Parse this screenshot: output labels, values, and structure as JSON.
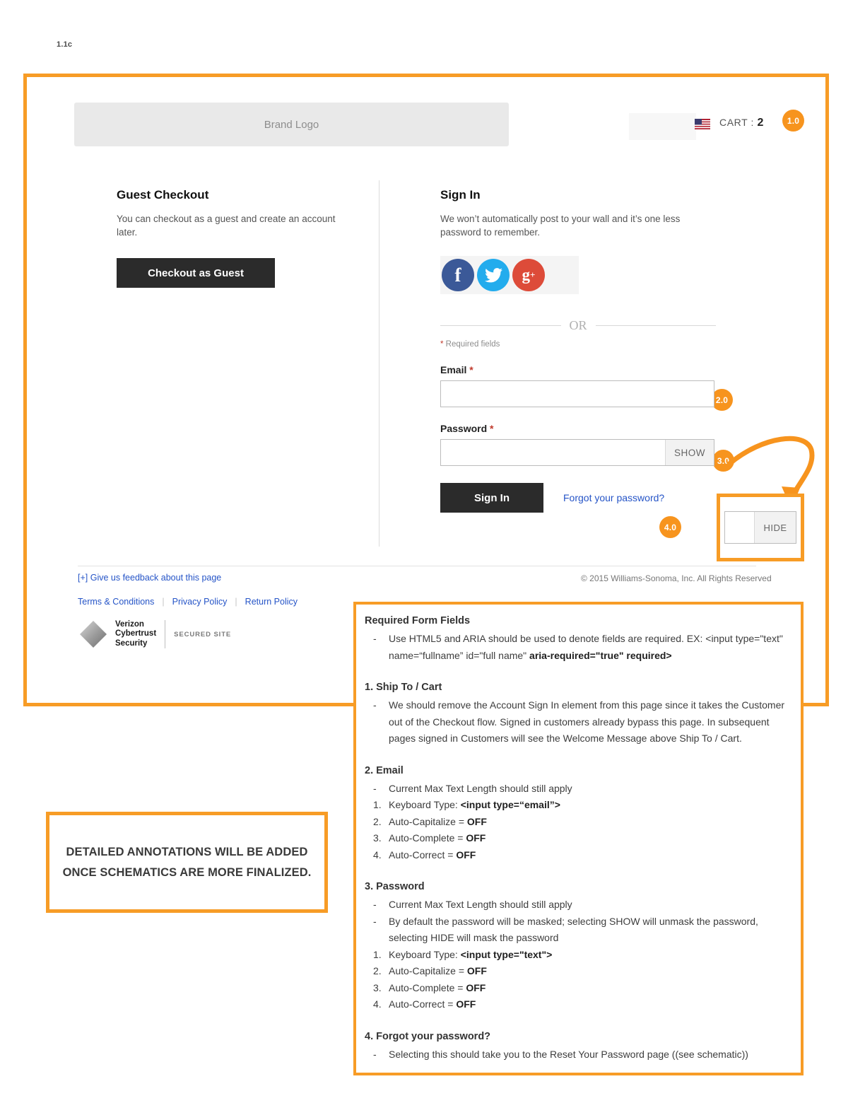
{
  "page_label": "1.1c",
  "header": {
    "brand_logo_text": "Brand Logo",
    "flag_icon": "us-flag-icon",
    "cart_label": "CART :",
    "cart_count": "2"
  },
  "callout_badges": {
    "b1": "1.0",
    "b2": "2.0",
    "b3": "3.0",
    "b4": "4.0"
  },
  "guest": {
    "title": "Guest Checkout",
    "description": "You can checkout as a guest and create an account later.",
    "button_label": "Checkout as Guest"
  },
  "signin": {
    "title": "Sign In",
    "description": "We won’t automatically post to your wall and it’s one less password to remember.",
    "social": [
      {
        "name": "facebook",
        "glyph": "f",
        "color": "#3b5998"
      },
      {
        "name": "twitter",
        "glyph": "",
        "color": "#23aced"
      },
      {
        "name": "googleplus",
        "glyph": "g",
        "color": "#dd4b39"
      }
    ],
    "or_text": "OR",
    "required_note_asterisk": "*",
    "required_note": " Required fields",
    "email_label": "Email ",
    "email_value": "",
    "email_placeholder": "",
    "password_label": "Password ",
    "password_value": "",
    "password_placeholder": "",
    "show_label": "SHOW",
    "hide_label": "HIDE",
    "submit_label": "Sign In",
    "forgot_label": "Forgot your password?",
    "required_asterisk": "*"
  },
  "footer": {
    "feedback": "[+] Give us feedback about this page",
    "copyright": "© 2015 Williams-Sonoma, Inc. All Rights Reserved",
    "links": [
      "Terms & Conditions",
      "Privacy Policy",
      "Return Policy"
    ],
    "separator": "|",
    "trust_name_line1": "Verizon",
    "trust_name_line2": "Cybertrust",
    "trust_name_line3": "Security",
    "trust_secured": "SECURED SITE"
  },
  "detailed_note": "DETAILED ANNOTATIONS WILL BE ADDED ONCE SCHEMATICS ARE MORE FINALIZED.",
  "annotations": {
    "s0_title": "Required Form Fields",
    "s0_i1_mark": "-",
    "s0_i1_a": "Use HTML5 and ARIA should be used to denote fields are required. EX:  <input type=\"text\" name=“fullname” id=\"full name\" ",
    "s0_i1_b": "aria-required=\"true\" required>",
    "s1_title": "1. Ship To / Cart",
    "s1_i1_mark": "-",
    "s1_i1": "We should remove the Account Sign In element from this page since it takes the Customer out of the Checkout flow. Signed in customers already bypass this page. In subsequent pages signed in Customers will see the Welcome Message above Ship To / Cart.",
    "s2_title": "2. Email",
    "s2_i1_mark": "-",
    "s2_i1": "Current Max Text Length should still apply",
    "s2_i2_mark": "1.",
    "s2_i2_a": "Keyboard Type: ",
    "s2_i2_b": "<input type=“email”>",
    "s2_i3_mark": "2.",
    "s2_i3_a": "Auto-Capitalize = ",
    "s2_i3_b": "OFF",
    "s2_i4_mark": "3.",
    "s2_i4_a": "Auto-Complete = ",
    "s2_i4_b": "OFF",
    "s2_i5_mark": "4.",
    "s2_i5_a": "Auto-Correct = ",
    "s2_i5_b": "OFF",
    "s3_title": "3. Password",
    "s3_i1_mark": "-",
    "s3_i1": "Current Max Text Length should still apply",
    "s3_i2_mark": "-",
    "s3_i2": "By default the password will be masked; selecting SHOW will unmask the password, selecting HIDE will mask the password",
    "s3_i3_mark": "1.",
    "s3_i3_a": "Keyboard Type: ",
    "s3_i3_b": "<input type=\"text\">",
    "s3_i4_mark": "2.",
    "s3_i4_a": "Auto-Capitalize = ",
    "s3_i4_b": "OFF",
    "s3_i5_mark": "3.",
    "s3_i5_a": "Auto-Complete = ",
    "s3_i5_b": "OFF",
    "s3_i6_mark": "4.",
    "s3_i6_a": "Auto-Correct = ",
    "s3_i6_b": "OFF",
    "s4_title": "4. Forgot your password?",
    "s4_i1_mark": "-",
    "s4_i1": "Selecting this should take you to the Reset Your Password page ((see schematic))"
  },
  "colors": {
    "annotation_orange": "#F7941E",
    "dark_button": "#2b2b2b",
    "link_blue": "#2554C7",
    "required_red": "#c0392b"
  }
}
